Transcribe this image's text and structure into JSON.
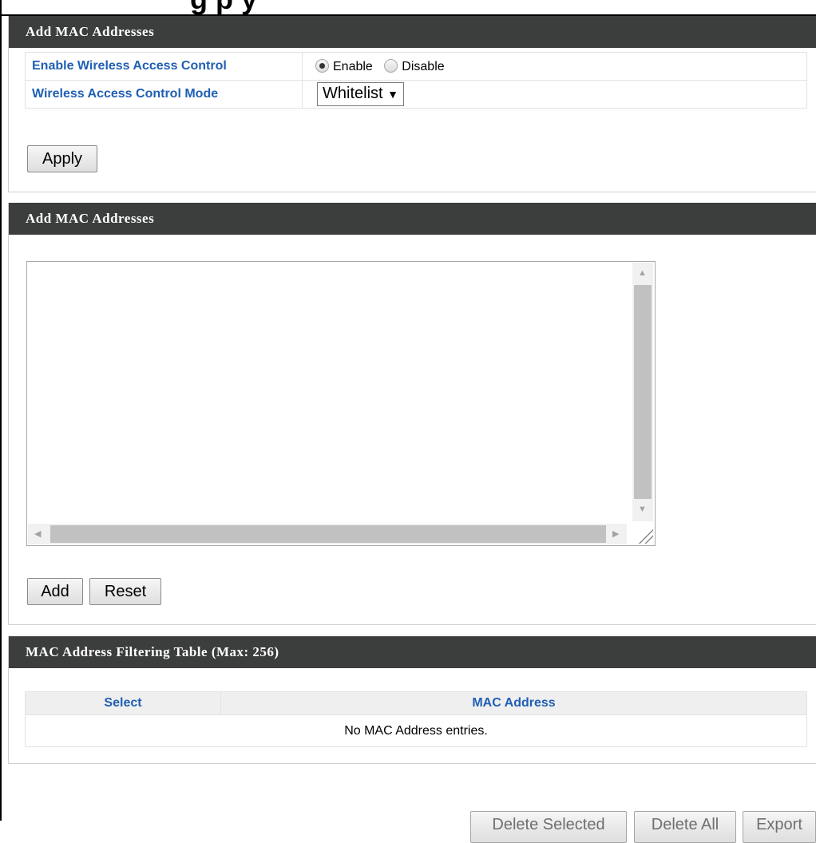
{
  "panels": [
    {
      "title": "Add MAC Addresses"
    },
    {
      "title": "Add MAC Addresses"
    },
    {
      "title": "MAC Address Filtering Table (Max: 256)"
    }
  ],
  "access_control": {
    "enable_label": "Enable Wireless Access Control",
    "enable_option": "Enable",
    "disable_option": "Disable",
    "selected": "Enable",
    "mode_label": "Wireless Access Control Mode",
    "mode_value": "Whitelist",
    "mode_arrow": "▼"
  },
  "buttons": {
    "apply": "Apply",
    "add": "Add",
    "reset": "Reset",
    "delete_selected": "Delete Selected",
    "delete_all": "Delete All",
    "export": "Export"
  },
  "mac_input": {
    "value": ""
  },
  "filter_table": {
    "columns": [
      "Select",
      "MAC Address"
    ],
    "empty_message": "No MAC Address entries."
  },
  "colors": {
    "header_bg": "#3c3e3d",
    "label_blue": "#1f5fb4"
  }
}
